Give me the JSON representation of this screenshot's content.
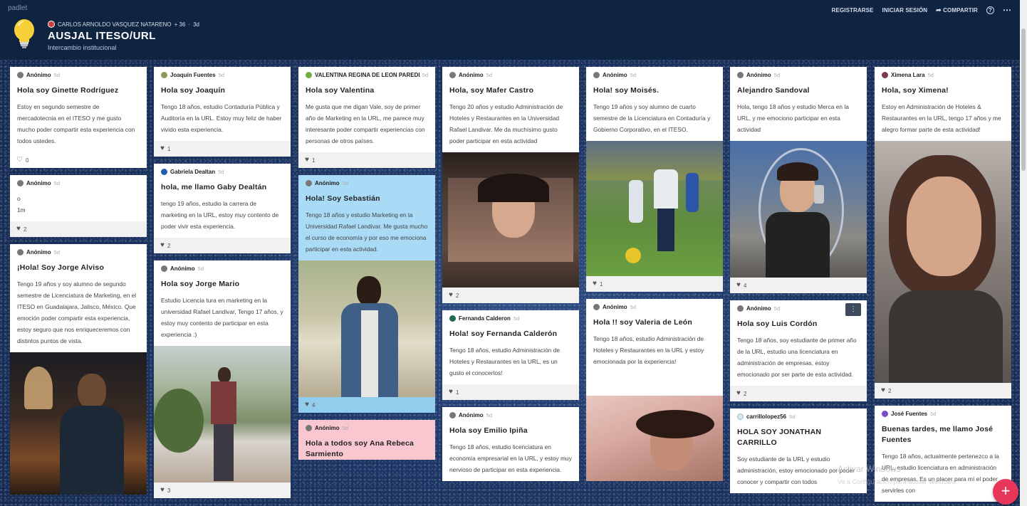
{
  "app": {
    "brand": "padlet"
  },
  "topbar": {
    "register": "REGISTRARSE",
    "login": "INICIAR SESIÓN",
    "share": "COMPARTIR",
    "share_icon": "share-arrow-icon",
    "help_icon": "help-icon",
    "more_icon": "more-dots-icon"
  },
  "board": {
    "owner": "CARLOS ARNOLDO VASQUEZ NATARENO",
    "contributors": "+ 36",
    "age": "3d",
    "title": "AUSJAL ITESO/URL",
    "subtitle": "Intercambio institucional"
  },
  "columns": [
    {
      "cards": [
        {
          "author": "Anónimo",
          "time": "5d",
          "title": "Hola soy Ginette Rodríguez",
          "body": "Estoy en segundo semestre de mercadotecnia en el ITESO y me gusto mucho poder compartir esta experiencia con todos ustedes.",
          "likes": "0"
        },
        {
          "author": "Anónimo",
          "time": "5d",
          "title": "",
          "body_lines": [
            "o",
            "1m"
          ],
          "likes": "2"
        },
        {
          "author": "Anónimo",
          "time": "5d",
          "title": "¡Hola! Soy Jorge Alviso",
          "body": "Tengo 19 años y soy alumno de segundo semestre de Licenciatura de Marketing, en el ITESO en Guadalajara, Jalisco, México. Que emoción poder compartir esta experiencia, estoy seguro que nos enriqueceremos con distintos puntos de vista."
        }
      ]
    },
    {
      "cards": [
        {
          "author": "Joaquín Fuentes",
          "time": "5d",
          "title": "Hola soy Joaquín",
          "body": "Tengo 18 años, estudio Contaduría Pública y Auditoría en la URL. Estoy muy feliz de haber vivido esta experiencia.",
          "likes": "1"
        },
        {
          "author": "Gabriela Dealtan",
          "time": "5d",
          "title": "hola, me llamo Gaby Dealtán",
          "body": "tengo 19 años, estudio la carrera de marketing en la URL, estoy muy contento de poder vivir esta experiencia.",
          "likes": "2"
        },
        {
          "author": "Anónimo",
          "time": "5d",
          "title": "Hola soy Jorge Mario",
          "body": "Estudio Licencia tura en marketing en la universidad Rafael Landivar, Tengo 17 años, y estoy muy contento de participar en esta experiencia :)",
          "likes": "3"
        }
      ]
    },
    {
      "cards": [
        {
          "author": "VALENTINA REGINA DE LEON PAREDES",
          "time": "5d",
          "title": "Hola soy Valentina",
          "body": "Me gusta que me digan Vale, soy de primer año de Marketing en la URL, me parece muy interesante poder compartir experiencias con personas de otros países.",
          "likes": "1"
        },
        {
          "author": "Anónimo",
          "time": "5d",
          "title": "Hola! Soy Sebastián",
          "body": "Tengo 18 años y estudio Marketing en la Universidad Rafael Landivar. Me gusta mucho el curso de economía y por eso me emociona participar en esta actividad.",
          "likes": "4"
        },
        {
          "author": "Anónimo",
          "time": "5d",
          "title": "Hola a todos soy Ana Rebeca Sarmiento",
          "body": ""
        }
      ]
    },
    {
      "cards": [
        {
          "author": "Anónimo",
          "time": "5d",
          "title": "Hola, soy Mafer Castro",
          "body": "Tengo 20 años y estudio Administración de Hoteles y Restaurantes en la Universidad Rafael Landivar. Me da muchísimo gusto poder participar en esta actividad",
          "likes": "2"
        },
        {
          "author": "Fernanda Calderon",
          "time": "5d",
          "title": "Hola! soy Fernanda Calderón",
          "body": "Tengo 18 años, estudio Administración de Hoteles y Restaurantes en la URL, es un gusto el conocerlos!",
          "likes": "1"
        },
        {
          "author": "Anónimo",
          "time": "5d",
          "title": "Hola soy Emilio Ipiña",
          "body": "Tengo 18 años, estudio licenciatura en economía empresarial en la URL, y estoy muy nervioso de participar en esta experiencia."
        }
      ]
    },
    {
      "cards": [
        {
          "author": "Anónimo",
          "time": "5d",
          "title": "Hola! soy Moisés.",
          "body": "Tengo 19 años y soy alumno de cuarto semestre de la Licenciatura en Contaduría y Gobierno Corporativo, en el ITESO.",
          "likes": "1"
        },
        {
          "author": "Anónimo",
          "time": "5d",
          "title": "Hola !! soy Valeria de León",
          "body": "Tengo 18 años, estudio Administración de Hoteles y Restaurantes en la URL y estoy emocionada por la experiencia!"
        }
      ]
    },
    {
      "cards": [
        {
          "author": "Anónimo",
          "time": "5d",
          "title": "Alejandro Sandoval",
          "body": "Hola, tengo 18 años y estudio Merca en la URL, y me emociono participar en esta actividad",
          "likes": "4"
        },
        {
          "author": "Anónimo",
          "time": "5d",
          "title": "Hola soy Luis Cordón",
          "body": "Tengo 18 años, soy estudiante de primer año de la URL, estudio una licenciatura en administración de empresas, estoy emocionado por ser parte de esta actividad.",
          "likes": "2"
        },
        {
          "author": "carrillolopez56",
          "time": "5d",
          "title": "HOLA SOY JONATHAN CARRILLO",
          "body": "Soy estudiante de la URL y estudio administración, estoy emocionado por poder conocer y compartir con todos"
        }
      ]
    },
    {
      "cards": [
        {
          "author": "Ximena Lara",
          "time": "5d",
          "title": "Hola, soy Ximena!",
          "body": "Estoy en Administración de Hoteles & Restaurantes en la URL, tengo 17 años y me alegro formar parte de esta actividad!",
          "likes": "2"
        },
        {
          "author": "José Fuentes",
          "time": "5d",
          "title": "Buenas tardes, me llamo José Fuentes",
          "body": "Tengo 18 años, actualmente pertenezco a la URL, estudio licenciatura en administración de empresas. Es un placer para mí el poder servirles con"
        }
      ]
    }
  ],
  "watermark": {
    "line1": "Activar Windows",
    "line2": "Ve a Configuración para activar Windows."
  },
  "fab": {
    "label": "+"
  }
}
